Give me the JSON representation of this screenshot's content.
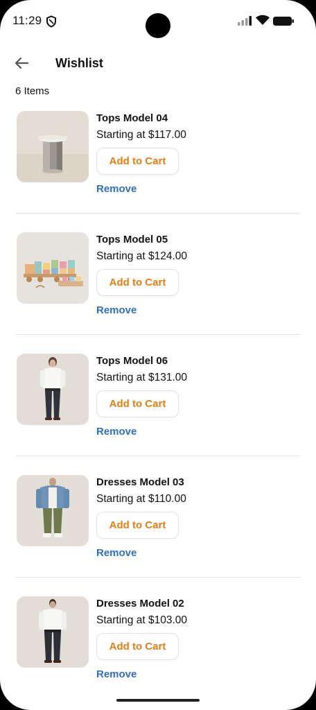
{
  "status": {
    "time": "11:29"
  },
  "header": {
    "title": "Wishlist",
    "back_icon": "arrow-left-icon"
  },
  "count_label": "6 Items",
  "items": [
    {
      "name": "Tops Model 04",
      "price": "Starting at $117.00",
      "add_label": "Add to Cart",
      "remove_label": "Remove",
      "image": "cylinder-stool"
    },
    {
      "name": "Tops Model 05",
      "price": "Starting at $124.00",
      "add_label": "Add to Cart",
      "remove_label": "Remove",
      "image": "toy-train"
    },
    {
      "name": "Tops Model 06",
      "price": "Starting at $131.00",
      "add_label": "Add to Cart",
      "remove_label": "Remove",
      "image": "person-white-shirt"
    },
    {
      "name": "Dresses Model 03",
      "price": "Starting at $110.00",
      "add_label": "Add to Cart",
      "remove_label": "Remove",
      "image": "person-denim-jacket"
    },
    {
      "name": "Dresses Model 02",
      "price": "Starting at $103.00",
      "add_label": "Add to Cart",
      "remove_label": "Remove",
      "image": "person-white-shirt-2"
    }
  ],
  "colors": {
    "accent": "#e87c10",
    "link": "#2e6fc4",
    "divider": "#e4e4e4"
  }
}
